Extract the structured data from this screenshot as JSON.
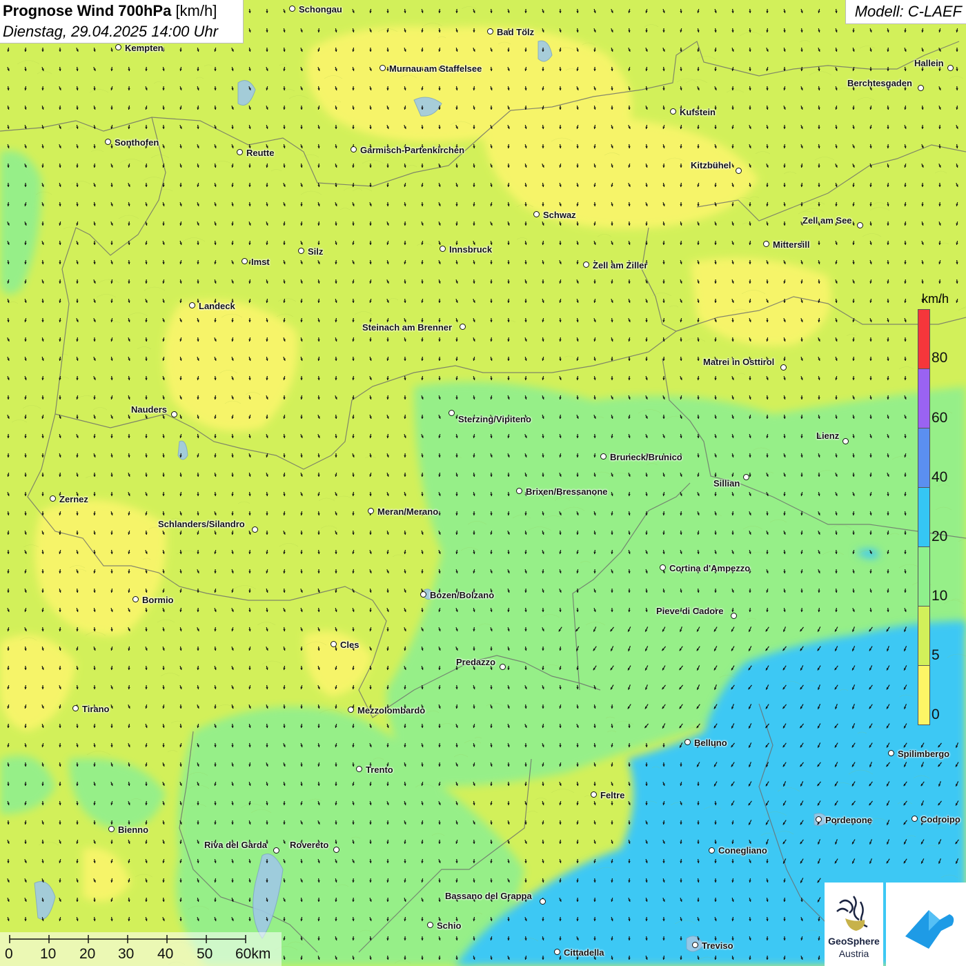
{
  "title": {
    "main": "Prognose Wind 700hPa",
    "unit": "[km/h]",
    "datetime": "Dienstag, 29.04.2025 14:00 Uhr"
  },
  "model": "Modell: C-LAEF",
  "legend": {
    "unit": "km/h",
    "ticks": [
      "80",
      "60",
      "40",
      "20",
      "10",
      "5",
      "0"
    ],
    "classes": [
      {
        "from": 0,
        "to": 5,
        "color": "#fdf566"
      },
      {
        "from": 5,
        "to": 10,
        "color": "#d2f05a"
      },
      {
        "from": 10,
        "to": 20,
        "color": "#8ff08c"
      },
      {
        "from": 20,
        "to": 40,
        "color": "#35c6f4"
      },
      {
        "from": 40,
        "to": 60,
        "color": "#5b8ff0"
      },
      {
        "from": 60,
        "to": 80,
        "color": "#9a63f2"
      },
      {
        "from": 80,
        "to": 100,
        "color": "#f5363b"
      }
    ]
  },
  "scalebar": {
    "labels": [
      "0",
      "10",
      "20",
      "30",
      "40",
      "50",
      "60km"
    ]
  },
  "logo": {
    "name": "GeoSphere",
    "sub": "Austria"
  },
  "cities": [
    {
      "name": "Schongau"
    },
    {
      "name": "Bad Tölz"
    },
    {
      "name": "Kempten"
    },
    {
      "name": "Murnau am Staffelsee"
    },
    {
      "name": "Hallein"
    },
    {
      "name": "Berchtesgaden"
    },
    {
      "name": "Kufstein"
    },
    {
      "name": "Sonthofen"
    },
    {
      "name": "Reutte"
    },
    {
      "name": "Garmisch-Partenkirchen"
    },
    {
      "name": "Kitzbühel"
    },
    {
      "name": "Schwaz"
    },
    {
      "name": "Zell am See"
    },
    {
      "name": "Mittersill"
    },
    {
      "name": "Innsbruck"
    },
    {
      "name": "Silz"
    },
    {
      "name": "Imst"
    },
    {
      "name": "Zell am Ziller"
    },
    {
      "name": "Landeck"
    },
    {
      "name": "Steinach am Brenner"
    },
    {
      "name": "Matrei in Osttirol"
    },
    {
      "name": "Nauders"
    },
    {
      "name": "Sterzing/Vipiteno"
    },
    {
      "name": "Lienz"
    },
    {
      "name": "Bruneck/Brunico"
    },
    {
      "name": "Sillian"
    },
    {
      "name": "Brixen/Bressanone"
    },
    {
      "name": "Zernez"
    },
    {
      "name": "Meran/Merano"
    },
    {
      "name": "Schlanders/Silandro"
    },
    {
      "name": "Cortina d'Ampezzo"
    },
    {
      "name": "Bozen/Bolzano"
    },
    {
      "name": "Bormio"
    },
    {
      "name": "Pieve di Cadore"
    },
    {
      "name": "Cles"
    },
    {
      "name": "Predazzo"
    },
    {
      "name": "Tirano"
    },
    {
      "name": "Mezzolombardo"
    },
    {
      "name": "Belluno"
    },
    {
      "name": "Spilimbergo"
    },
    {
      "name": "Trento"
    },
    {
      "name": "Feltre"
    },
    {
      "name": "Pordenone"
    },
    {
      "name": "Codroipo"
    },
    {
      "name": "Bienno"
    },
    {
      "name": "Riva del Garda"
    },
    {
      "name": "Rovereto"
    },
    {
      "name": "Conegliano"
    },
    {
      "name": "Bassano del Grappa"
    },
    {
      "name": "Schio"
    },
    {
      "name": "Treviso"
    },
    {
      "name": "Cittadella"
    }
  ],
  "colors": {
    "fast_zone": "#3ec8f4",
    "mid_zone": "#8ef08e",
    "slow_zone": "#fdf566",
    "base_zone": "#d2f05a"
  }
}
